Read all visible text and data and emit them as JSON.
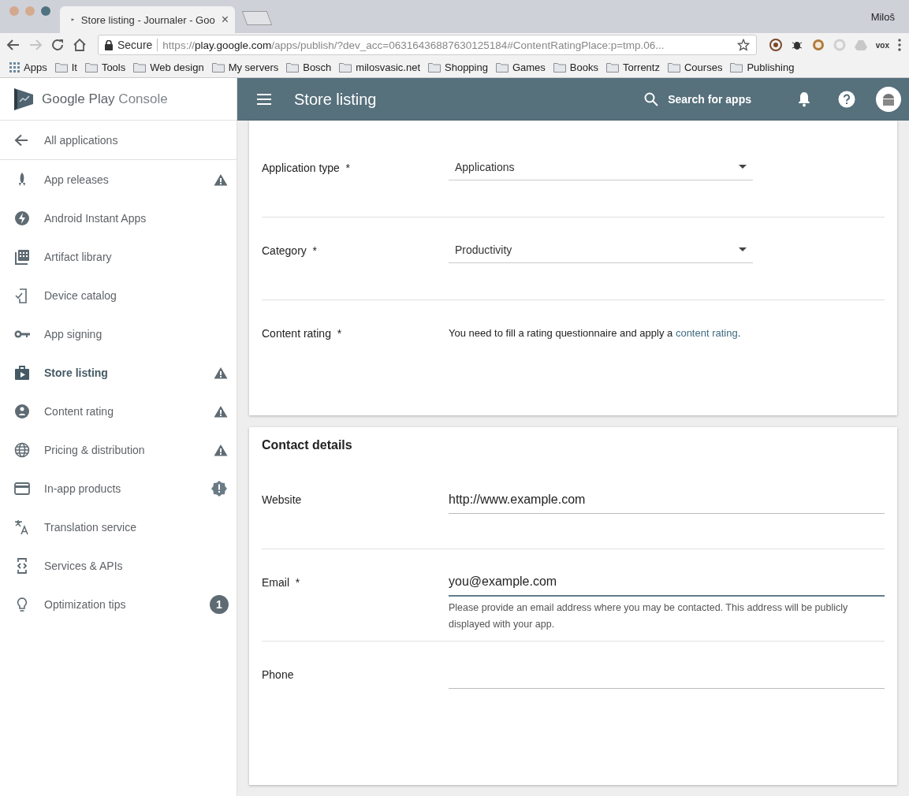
{
  "browser": {
    "tab": {
      "title": "Store listing - Journaler - Goo",
      "close": "×"
    },
    "user": "Miloš",
    "address": {
      "secure": "Secure",
      "scheme": "https://",
      "host": "play.google.com",
      "path": "/apps/publish/?dev_acc=06316436887630125184#ContentRatingPlace:p=tmp.06..."
    },
    "extension_label": "vox",
    "bookmarks": [
      {
        "label": "Apps",
        "kind": "apps"
      },
      {
        "label": "It",
        "kind": "folder"
      },
      {
        "label": "Tools",
        "kind": "folder"
      },
      {
        "label": "Web design",
        "kind": "folder"
      },
      {
        "label": "My servers",
        "kind": "folder"
      },
      {
        "label": "Bosch",
        "kind": "folder"
      },
      {
        "label": "milosvasic.net",
        "kind": "folder"
      },
      {
        "label": "Shopping",
        "kind": "folder"
      },
      {
        "label": "Games",
        "kind": "folder"
      },
      {
        "label": "Books",
        "kind": "folder"
      },
      {
        "label": "Torrentz",
        "kind": "folder"
      },
      {
        "label": "Courses",
        "kind": "folder"
      },
      {
        "label": "Publishing",
        "kind": "folder"
      }
    ]
  },
  "sidebar": {
    "logo": {
      "brand": "Google Play",
      "product": "Console"
    },
    "back": "All applications",
    "items": [
      {
        "label": "App releases",
        "selected": false,
        "badge": {
          "kind": "warning"
        }
      },
      {
        "label": "Android Instant Apps",
        "selected": false
      },
      {
        "label": "Artifact library",
        "selected": false
      },
      {
        "label": "Device catalog",
        "selected": false
      },
      {
        "label": "App signing",
        "selected": false
      },
      {
        "label": "Store listing",
        "selected": true,
        "badge": {
          "kind": "warning"
        }
      },
      {
        "label": "Content rating",
        "selected": false,
        "badge": {
          "kind": "warning"
        }
      },
      {
        "label": "Pricing & distribution",
        "selected": false,
        "badge": {
          "kind": "warning"
        }
      },
      {
        "label": "In-app products",
        "selected": false,
        "badge": {
          "kind": "alert"
        }
      },
      {
        "label": "Translation service",
        "selected": false
      },
      {
        "label": "Services & APIs",
        "selected": false
      },
      {
        "label": "Optimization tips",
        "selected": false,
        "badge": {
          "kind": "count",
          "text": "1"
        }
      }
    ]
  },
  "header": {
    "title": "Store listing",
    "search": "Search for apps"
  },
  "sections": [
    {
      "rows": [
        {
          "label": "Application type",
          "required": "*",
          "kind": "dropdown",
          "value": "Applications"
        },
        {
          "label": "Category",
          "required": "*",
          "kind": "dropdown",
          "value": "Productivity"
        },
        {
          "label": "Content rating",
          "required": "*",
          "kind": "note",
          "text": "You need to fill a rating questionnaire and apply a ",
          "link": "content rating",
          "after": "."
        }
      ]
    },
    {
      "title": "Contact details",
      "rows": [
        {
          "label": "Website",
          "kind": "text",
          "value": "http://www.example.com",
          "focused": false
        },
        {
          "label": "Email",
          "required": "*",
          "kind": "text",
          "value": "you@example.com",
          "focused": true,
          "help": "Please provide an email address where you may be contacted. This address will be publicly displayed with your app."
        },
        {
          "label": "Phone",
          "kind": "text",
          "focused": false
        }
      ]
    }
  ]
}
